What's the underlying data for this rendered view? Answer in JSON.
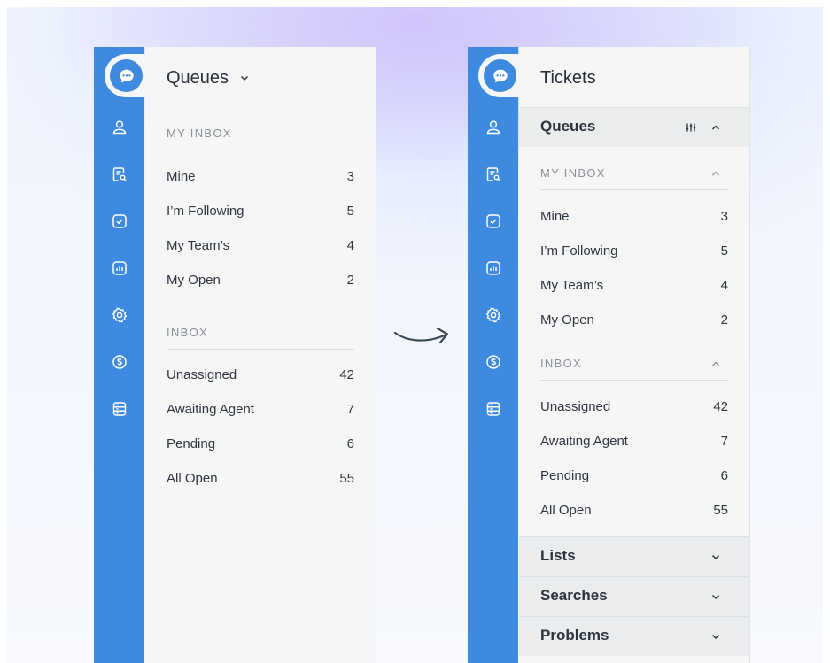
{
  "left_panel": {
    "title": "Queues",
    "my_inbox_label": "MY INBOX",
    "my_inbox_items": [
      {
        "label": "Mine",
        "count": "3"
      },
      {
        "label": "I’m Following",
        "count": "5"
      },
      {
        "label": "My Team’s",
        "count": "4"
      },
      {
        "label": "My Open",
        "count": "2"
      }
    ],
    "inbox_label": "INBOX",
    "inbox_items": [
      {
        "label": "Unassigned",
        "count": "42"
      },
      {
        "label": "Awaiting Agent",
        "count": "7"
      },
      {
        "label": "Pending",
        "count": "6"
      },
      {
        "label": "All Open",
        "count": "55"
      }
    ]
  },
  "right_panel": {
    "title": "Tickets",
    "queues_header": "Queues",
    "my_inbox_label": "MY INBOX",
    "my_inbox_items": [
      {
        "label": "Mine",
        "count": "3"
      },
      {
        "label": "I’m Following",
        "count": "5"
      },
      {
        "label": "My Team’s",
        "count": "4"
      },
      {
        "label": "My Open",
        "count": "2"
      }
    ],
    "inbox_label": "INBOX",
    "inbox_items": [
      {
        "label": "Unassigned",
        "count": "42"
      },
      {
        "label": "Awaiting Agent",
        "count": "7"
      },
      {
        "label": "Pending",
        "count": "6"
      },
      {
        "label": "All Open",
        "count": "55"
      }
    ],
    "lists_header": "Lists",
    "searches_header": "Searches",
    "problems_header": "Problems"
  },
  "rail_icons": [
    "chat-icon",
    "user-icon",
    "search-document-icon",
    "checkbox-icon",
    "chart-icon",
    "gear-icon",
    "dollar-icon",
    "database-icon"
  ],
  "colors": {
    "rail": "#3d8ae0",
    "panel": "#f6f6f7",
    "text": "#2e3640",
    "muted": "#8a9099"
  }
}
